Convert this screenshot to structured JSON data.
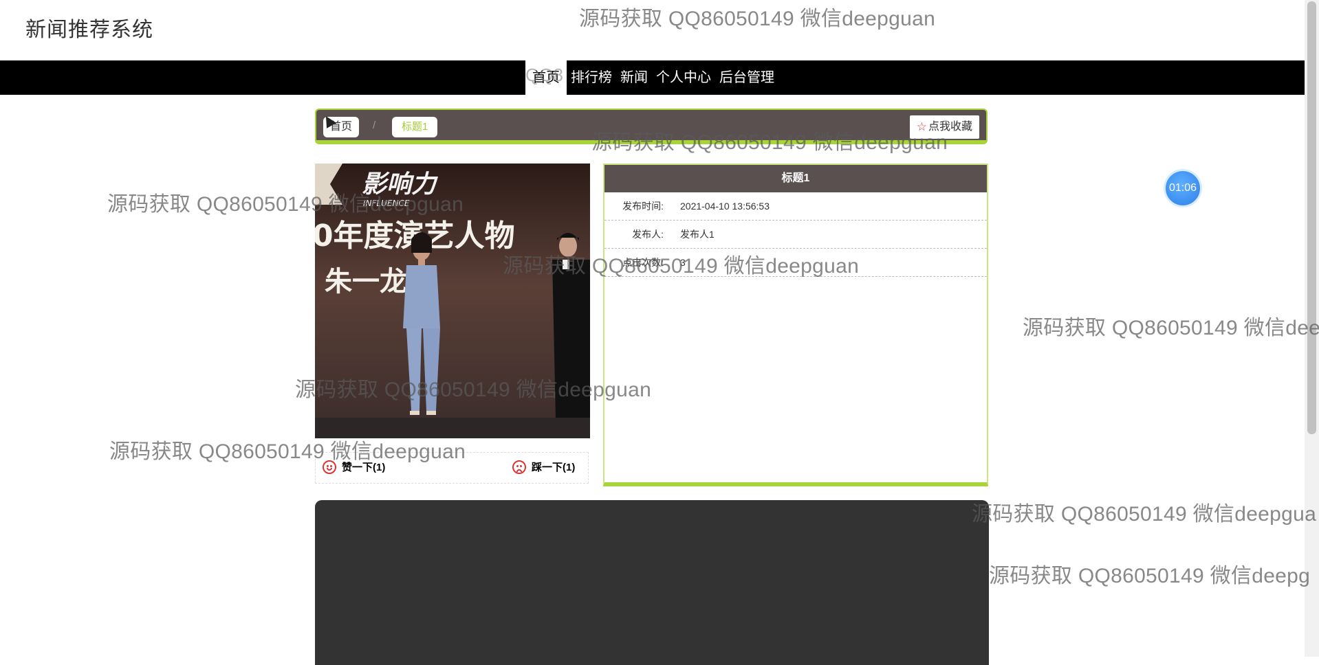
{
  "header": {
    "site_title": "新闻推荐系统"
  },
  "nav": {
    "items": [
      {
        "label": "首页",
        "active": true
      },
      {
        "label": "排行榜"
      },
      {
        "label": "新闻"
      },
      {
        "label": "个人中心"
      },
      {
        "label": "后台管理"
      }
    ]
  },
  "breadcrumb": {
    "home": "首页",
    "separator": "/",
    "current": "标题1"
  },
  "favorite_button": {
    "icon": "star-icon",
    "label": "点我收藏"
  },
  "news": {
    "title": "标题1",
    "image": {
      "banner_text": "影响力",
      "banner_sub": "INFLUENCE",
      "line1": "0年度演艺人物",
      "line2": "朱一龙"
    },
    "fields": [
      {
        "label": "发布时间:",
        "value": "2021-04-10 13:56:53"
      },
      {
        "label": "发布人:",
        "value": "发布人1"
      },
      {
        "label": "点击次数:",
        "value": "3"
      }
    ]
  },
  "votes": {
    "like_label": "赞一下(1)",
    "dislike_label": "踩一下(1)"
  },
  "timer": {
    "text": "01:06"
  },
  "watermark": {
    "text": "源码获取 QQ86050149 微信deepguan",
    "nav_fragment": "QQ8",
    "cut_1": "源码获取 QQ86050149 微信dee",
    "cut_2": "源码获取 QQ86050149 微信deepgua",
    "cut_3": "源码获取 QQ86050149 微信deepg"
  },
  "colors": {
    "navbar": "#000000",
    "panel_header": "#5b5050",
    "accent_green": "#a8d43a",
    "video_bg": "#333333",
    "timer_blue": "#2d7ee8"
  }
}
